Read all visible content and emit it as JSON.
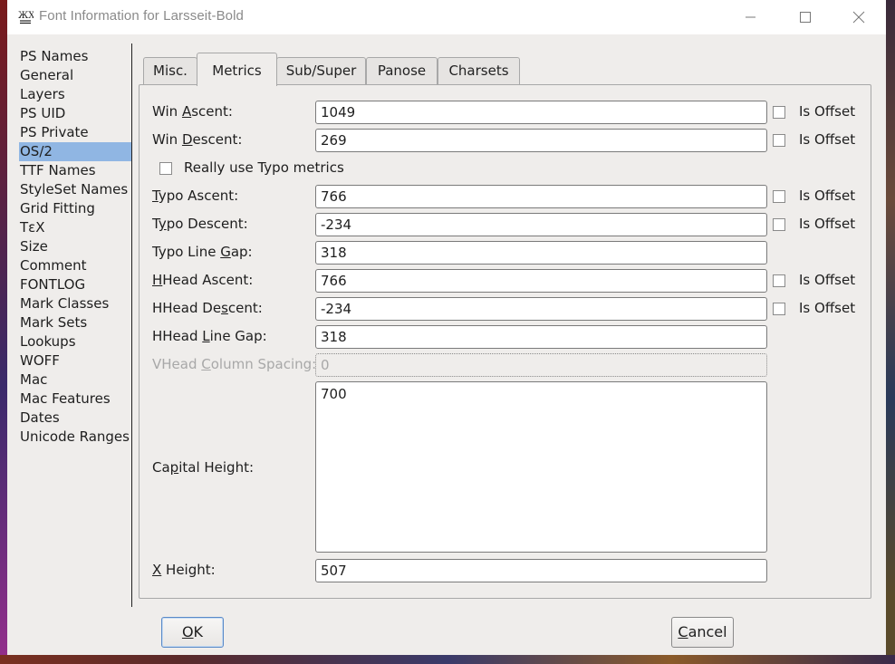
{
  "window": {
    "title": "Font Information for Larsseit-Bold",
    "icon": "fontforge-app-icon",
    "controls": {
      "minimize": "minimize-icon",
      "maximize": "maximize-icon",
      "close": "close-icon"
    }
  },
  "sidebar": {
    "items": [
      {
        "label": "PS Names",
        "selected": false
      },
      {
        "label": "General",
        "selected": false
      },
      {
        "label": "Layers",
        "selected": false
      },
      {
        "label": "PS UID",
        "selected": false
      },
      {
        "label": "PS Private",
        "selected": false
      },
      {
        "label": "OS/2",
        "selected": true
      },
      {
        "label": "TTF Names",
        "selected": false
      },
      {
        "label": "StyleSet Names",
        "selected": false
      },
      {
        "label": "Grid Fitting",
        "selected": false
      },
      {
        "label": "TεX",
        "selected": false
      },
      {
        "label": "Size",
        "selected": false
      },
      {
        "label": "Comment",
        "selected": false
      },
      {
        "label": "FONTLOG",
        "selected": false
      },
      {
        "label": "Mark Classes",
        "selected": false
      },
      {
        "label": "Mark Sets",
        "selected": false
      },
      {
        "label": "Lookups",
        "selected": false
      },
      {
        "label": "WOFF",
        "selected": false
      },
      {
        "label": "Mac",
        "selected": false
      },
      {
        "label": "Mac Features",
        "selected": false
      },
      {
        "label": "Dates",
        "selected": false
      },
      {
        "label": "Unicode Ranges",
        "selected": false
      }
    ],
    "selected_color": "#90b6e3"
  },
  "tabs": [
    {
      "label": "Misc.",
      "active": false
    },
    {
      "label": "Metrics",
      "active": true
    },
    {
      "label": "Sub/Super",
      "active": false
    },
    {
      "label": "Panose",
      "active": false
    },
    {
      "label": "Charsets",
      "active": false
    }
  ],
  "metrics": {
    "win_ascent": {
      "label_pre": "Win ",
      "label_u": "A",
      "label_post": "scent:",
      "value": "1049",
      "is_offset_label": "Is Offset",
      "is_offset": false
    },
    "win_descent": {
      "label_pre": "Win ",
      "label_u": "D",
      "label_post": "escent:",
      "value": "269",
      "is_offset_label": "Is Offset",
      "is_offset": false
    },
    "really_use_typo": {
      "label": "Really use Typo metrics",
      "checked": false
    },
    "typo_ascent": {
      "label_pre": "",
      "label_u": "T",
      "label_post": "ypo Ascent:",
      "value": "766",
      "is_offset_label": "Is Offset",
      "is_offset": false
    },
    "typo_descent": {
      "label_pre": "T",
      "label_u": "y",
      "label_post": "po Descent:",
      "value": "-234",
      "is_offset_label": "Is Offset",
      "is_offset": false
    },
    "typo_line_gap": {
      "label_pre": "Typo Line ",
      "label_u": "G",
      "label_post": "ap:",
      "value": "318"
    },
    "hhead_ascent": {
      "label_pre": "",
      "label_u": "H",
      "label_post": "Head Ascent:",
      "value": "766",
      "is_offset_label": "Is Offset",
      "is_offset": false
    },
    "hhead_descent": {
      "label_pre": "HHead De",
      "label_u": "s",
      "label_post": "cent:",
      "value": "-234",
      "is_offset_label": "Is Offset",
      "is_offset": false
    },
    "hhead_line_gap": {
      "label_pre": "HHead ",
      "label_u": "L",
      "label_post": "ine Gap:",
      "value": "318"
    },
    "vhead_column_spacing": {
      "label_pre": "VHead ",
      "label_u": "C",
      "label_post": "olumn Spacing:",
      "value": "0",
      "disabled": true
    },
    "capital_height": {
      "label_pre": "Ca",
      "label_u": "p",
      "label_post": "ital Height:",
      "value": "700"
    },
    "x_height": {
      "label_pre": "",
      "label_u": "X",
      "label_post": " Height:",
      "value": "507"
    }
  },
  "buttons": {
    "ok": {
      "label_u": "O",
      "label_post": "K"
    },
    "cancel": {
      "label_u": "C",
      "label_post": "ancel"
    }
  }
}
